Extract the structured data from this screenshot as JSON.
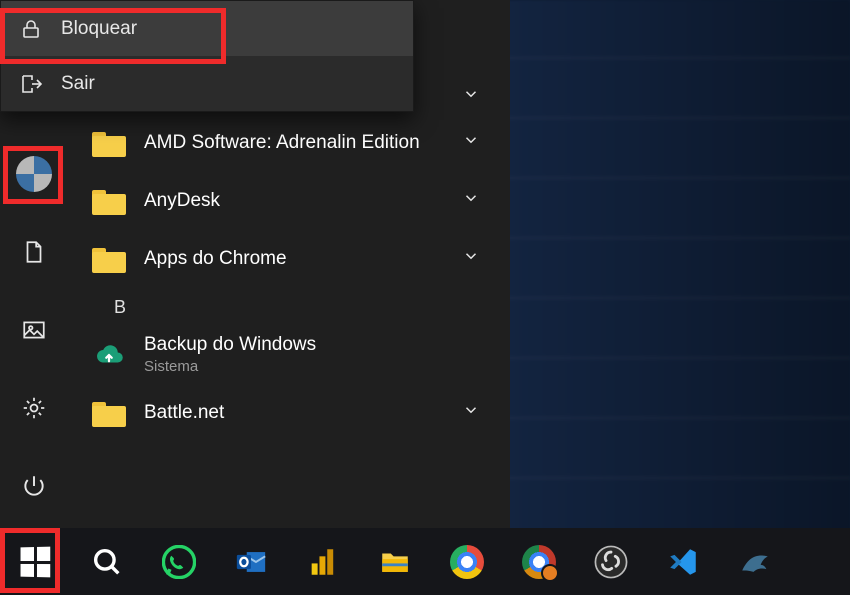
{
  "user_menu": {
    "lock": "Bloquear",
    "signout": "Sair"
  },
  "apps": {
    "amd": "AMD Software: Adrenalin Edition",
    "anydesk": "AnyDesk",
    "chrome_apps": "Apps do Chrome",
    "letter_b": "B",
    "backup_title": "Backup do Windows",
    "backup_sub": "Sistema",
    "battlenet": "Battle.net"
  }
}
